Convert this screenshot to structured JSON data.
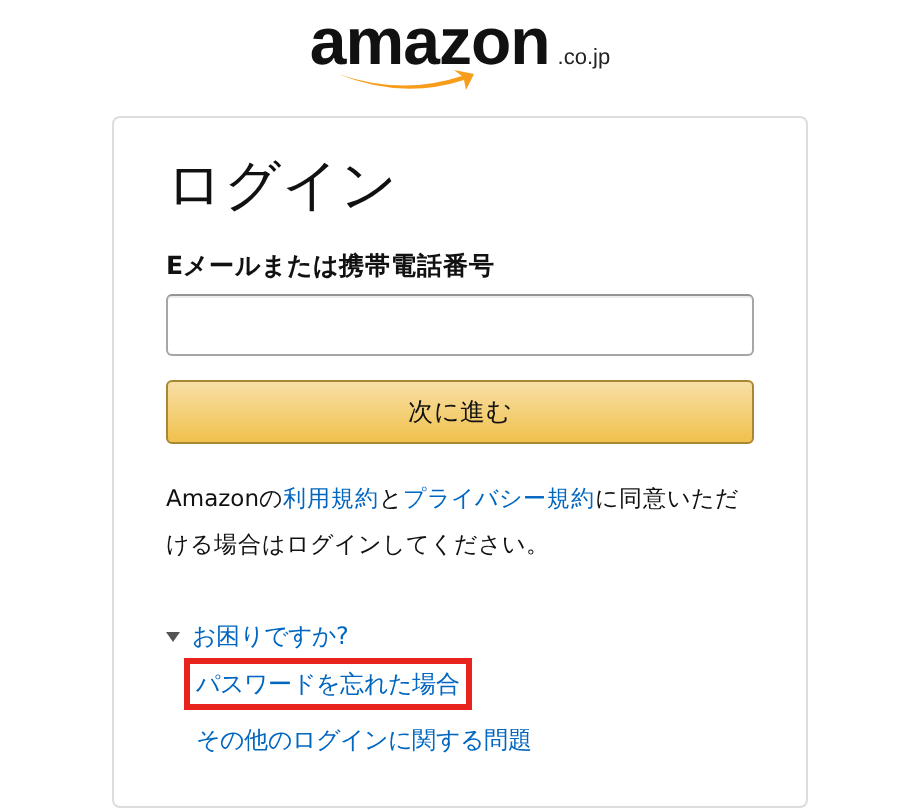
{
  "logo": {
    "wordmark": "amazon",
    "suffix": ".co.jp"
  },
  "card": {
    "title": "ログイン",
    "email_field": {
      "label": "Eメールまたは携帯電話番号"
    },
    "continue_button": "次に進む",
    "agreement": [
      {
        "text": "Amazonの",
        "link": false
      },
      {
        "text": "利用規約",
        "link": true
      },
      {
        "text": "と",
        "link": false
      },
      {
        "text": "プライバシー規約",
        "link": true
      },
      {
        "text": "に同意いただける場合はログインしてください。",
        "link": false
      }
    ],
    "help": {
      "label": "お困りですか?",
      "expanded": true,
      "links": [
        {
          "text": "パスワードを忘れた場合",
          "highlighted": true
        },
        {
          "text": "その他のログインに関する問題",
          "highlighted": false
        }
      ]
    }
  }
}
